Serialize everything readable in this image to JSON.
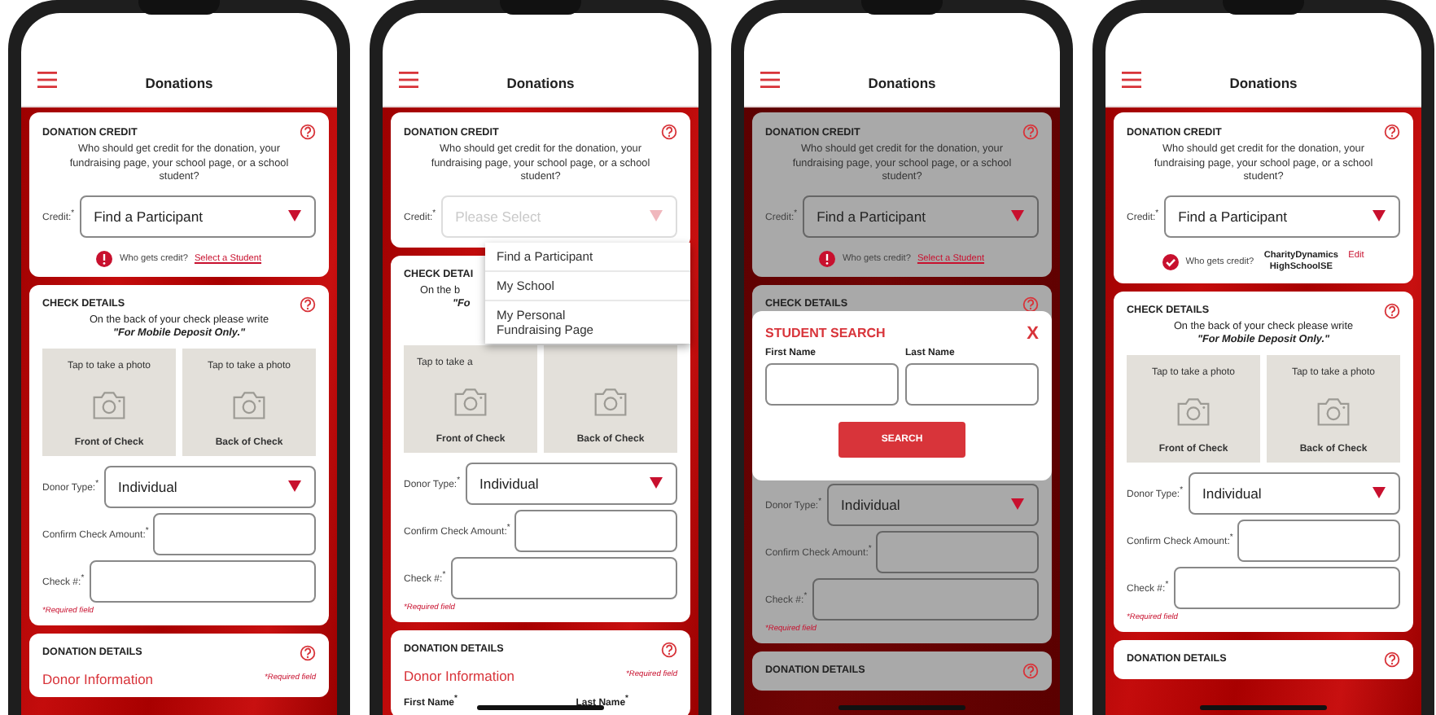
{
  "phones": [
    {
      "header": {
        "title": "Donations"
      },
      "dimmed": false,
      "home_indicator": false,
      "credit": {
        "title": "DONATION CREDIT",
        "help": true,
        "description": "Who should get credit for the donation, your fundraising page, your school page, or a school student?",
        "label": "Credit:$^{*}$",
        "select": {
          "value": "Find a Participant"
        },
        "note": {
          "kind": "warning",
          "label": "Who gets credit?",
          "link": "Select a Student"
        }
      },
      "check": {
        "title": "CHECK DETAILS",
        "help": true,
        "instruction": "On the back of your check please write",
        "emphasis": "\"For Mobile Deposit Only.\"",
        "photos": [
          {
            "hint": "Tap to take a photo",
            "label": "Front of Check"
          },
          {
            "hint": "Tap to take a photo",
            "label": "Back of Check"
          }
        ],
        "donor_type": {
          "label": "Donor Type:$^{*}$",
          "value": "Individual"
        },
        "fields": [
          {
            "label": "Confirm Check Amount:$^{*}$"
          },
          {
            "label": "Check #:$^{*}$"
          }
        ],
        "note": "*Required field"
      },
      "details": {
        "title": "DONATION DETAILS",
        "help": true,
        "section": {
          "title": "Donor Information",
          "note": "*Required field"
        }
      }
    },
    {
      "header": {
        "title": "Donations"
      },
      "dimmed": false,
      "home_indicator": true,
      "credit": {
        "title": "DONATION CREDIT",
        "help": true,
        "description": "Who should get credit for the donation, your fundraising page, your school page, or a school student?",
        "label": "Credit:$^{*}$",
        "select": {
          "placeholder": "Please Select"
        },
        "dropdown": [
          "Find a Participant",
          "My School",
          "My Personal Fundraising Page"
        ]
      },
      "check": {
        "title": "CHECK DETAI",
        "help": false,
        "instruction": "On the b",
        "emphasis": "\"Fo",
        "photos": [
          {
            "hint": "Tap to take a",
            "label": "Front of Check"
          },
          {
            "label": "Back of Check"
          }
        ],
        "donor_type": {
          "label": "Donor Type:$^{*}$",
          "value": "Individual"
        },
        "fields": [
          {
            "label": "Confirm Check Amount:$^{*}$"
          },
          {
            "label": "Check #:$^{*}$"
          }
        ],
        "note": "*Required field"
      },
      "details": {
        "title": "DONATION DETAILS",
        "help": true,
        "section": {
          "title": "Donor Information",
          "note": "*Required field"
        },
        "names": [
          "First Name$^{*}$",
          "Last Name$^{*}$"
        ]
      }
    },
    {
      "header": {
        "title": "Donations"
      },
      "dimmed": true,
      "home_indicator": true,
      "credit": {
        "title": "DONATION CREDIT",
        "help": true,
        "description": "Who should get credit for the donation, your fundraising page, your school page, or a school student?",
        "label": "Credit:$^{*}$",
        "select": {
          "value": "Find a Participant"
        },
        "note": {
          "kind": "warning",
          "label": "Who gets credit?",
          "link": "Select a Student"
        }
      },
      "check": {
        "title": "CHECK DETAILS",
        "help": true,
        "modal": {
          "title": "STUDENT SEARCH",
          "close": "X",
          "fields": [
            {
              "label": "First Name"
            },
            {
              "label": "Last Name"
            }
          ],
          "button": "SEARCH"
        },
        "donor_type": {
          "label": "Donor Type:$^{*}$",
          "value": "Individual"
        },
        "fields": [
          {
            "label": "Confirm Check Amount:$^{*}$"
          },
          {
            "label": "Check #:$^{*}$"
          }
        ],
        "note": "*Required field"
      },
      "details": {
        "title": "DONATION DETAILS",
        "help": true
      }
    },
    {
      "header": {
        "title": "Donations"
      },
      "dimmed": false,
      "home_indicator": true,
      "credit": {
        "title": "DONATION CREDIT",
        "help": true,
        "description": "Who should get credit for the donation, your fundraising page, your school page, or a school student?",
        "label": "Credit:$^{*}$",
        "select": {
          "value": "Find a Participant"
        },
        "note": {
          "kind": "done",
          "label": "Who gets credit?",
          "value": "CharityDynamics HighSchoolSE",
          "link": "Edit"
        }
      },
      "check": {
        "title": "CHECK DETAILS",
        "help": true,
        "instruction": "On the back of your check please write",
        "emphasis": "\"For Mobile Deposit Only.\"",
        "photos": [
          {
            "hint": "Tap to take a photo",
            "label": "Front of Check"
          },
          {
            "hint": "Tap to take a photo",
            "label": "Back of Check"
          }
        ],
        "donor_type": {
          "label": "Donor Type:$^{*}$",
          "value": "Individual"
        },
        "fields": [
          {
            "label": "Confirm Check Amount:$^{*}$"
          },
          {
            "label": "Check #:$^{*}$"
          }
        ],
        "note": "*Required field"
      },
      "details": {
        "title": "DONATION DETAILS",
        "help": true
      }
    }
  ]
}
